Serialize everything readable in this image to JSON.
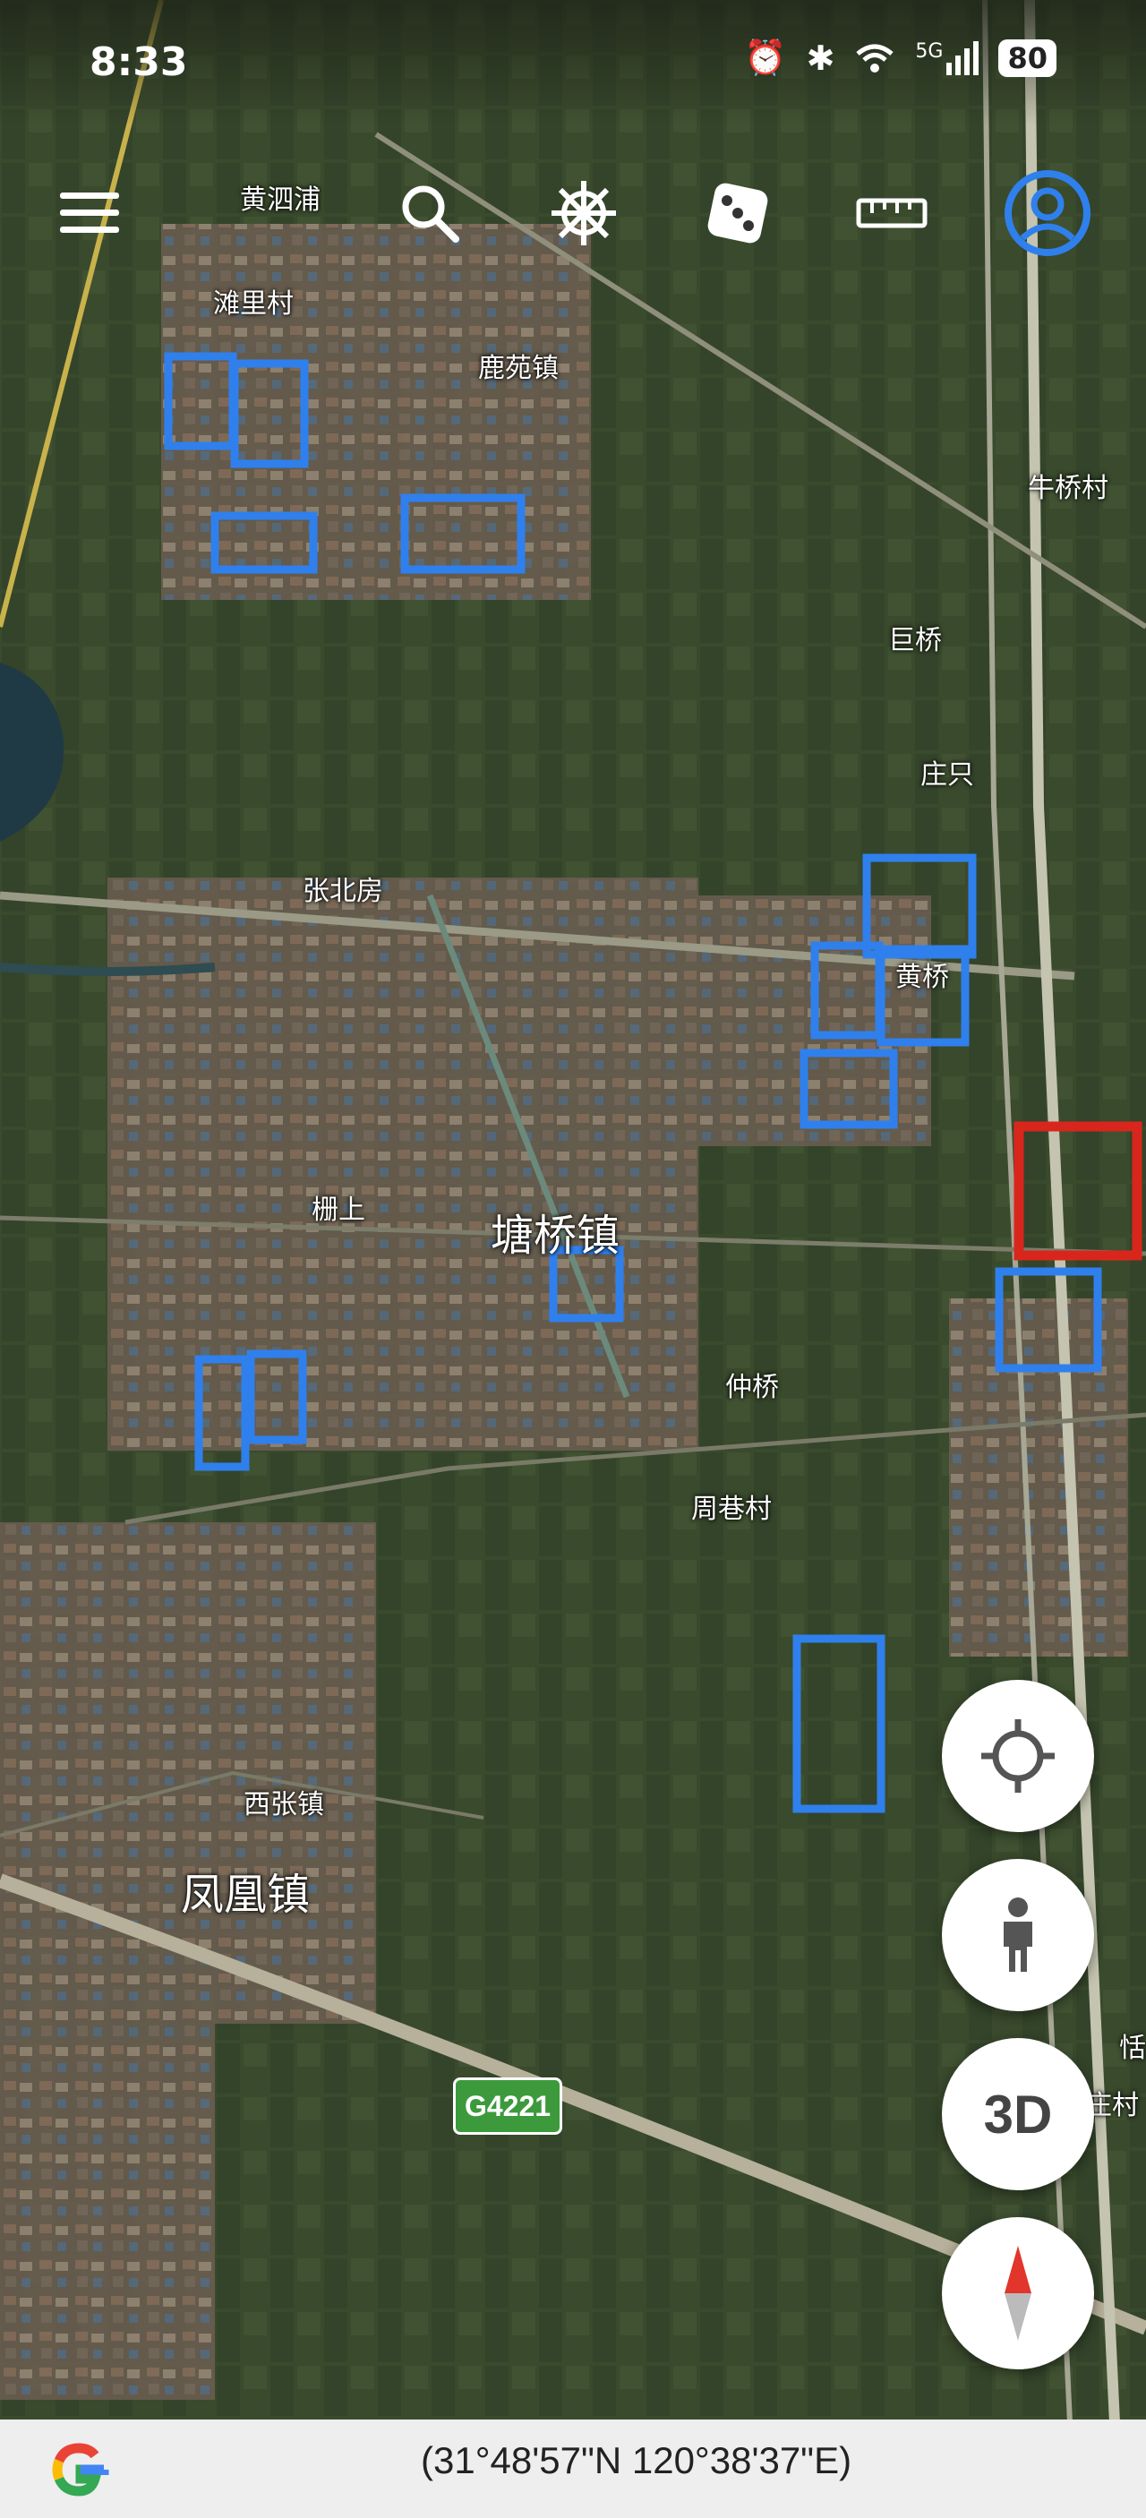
{
  "status_bar": {
    "time": "8:33",
    "icons": [
      "alarm-icon",
      "bluetooth-icon",
      "wifi-icon",
      "signal-5g-icon"
    ],
    "network": "5G",
    "battery": "80"
  },
  "toolbar": {
    "icons": [
      "menu-icon",
      "search-icon",
      "ship-wheel-icon",
      "dice-icon",
      "ruler-icon",
      "profile-icon"
    ]
  },
  "map": {
    "place_labels": [
      {
        "text": "黄泗浦",
        "size": "small"
      },
      {
        "text": "滩里村",
        "size": "small"
      },
      {
        "text": "鹿苑镇",
        "size": "small"
      },
      {
        "text": "牛桥村",
        "size": "small"
      },
      {
        "text": "巨桥",
        "size": "small"
      },
      {
        "text": "庄只",
        "size": "small"
      },
      {
        "text": "张北房",
        "size": "small"
      },
      {
        "text": "黄桥",
        "size": "small"
      },
      {
        "text": "栅上",
        "size": "small"
      },
      {
        "text": "塘桥镇",
        "size": "large"
      },
      {
        "text": "仲桥",
        "size": "small"
      },
      {
        "text": "周巷村",
        "size": "small"
      },
      {
        "text": "西张镇",
        "size": "small"
      },
      {
        "text": "凤凰镇",
        "size": "large"
      },
      {
        "text": "恬",
        "size": "small"
      },
      {
        "text": "庄村",
        "size": "small"
      }
    ],
    "highway_shield": "G4221",
    "marker_colors": {
      "blue": "#2f80ed",
      "red": "#d9261c"
    }
  },
  "fabs": {
    "icons": [
      "locate-icon",
      "street-view-person-icon",
      "compass-icon"
    ],
    "three_d_label": "3D"
  },
  "bottom_bar": {
    "logo": "google-g-logo",
    "coordinates": "(31°48'57\"N 120°38'37\"E)"
  }
}
